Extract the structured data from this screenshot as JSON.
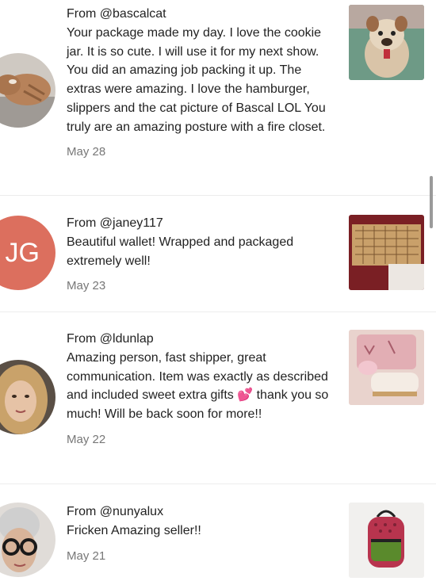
{
  "reviews": [
    {
      "from": "From @bascalcat",
      "text": "Your package made my day. I love the cookie jar. It is so cute. I will use it for my next show. You did an amazing job packing it up. The extras were amazing. I love the hamburger, slippers and the cat picture of Bascal LOL You truly are an amazing posture with a fire closet.",
      "date": "May 28",
      "avatar": "cat-photo",
      "thumb": "bulldog-cookie-jar"
    },
    {
      "from": "From @janey117",
      "text": "Beautiful wallet! Wrapped and packaged extremely well!",
      "date": "May 23",
      "avatar_initials": "JG",
      "avatar_color": "#dc6f5e",
      "thumb": "monogram-wallet"
    },
    {
      "from": "From @ldunlap",
      "text": "Amazing person, fast shipper, great communication. Item was exactly as described and included sweet extra gifts 💕 thank you so much! Will be back soon for more!!",
      "date": "May 22",
      "avatar": "woman-photo",
      "thumb": "pink-monogram-items"
    },
    {
      "from": "From @nunyalux",
      "text": "Fricken Amazing seller!!",
      "date": "May 21",
      "avatar": "woman-glasses-photo",
      "thumb": "red-green-backpack"
    }
  ]
}
